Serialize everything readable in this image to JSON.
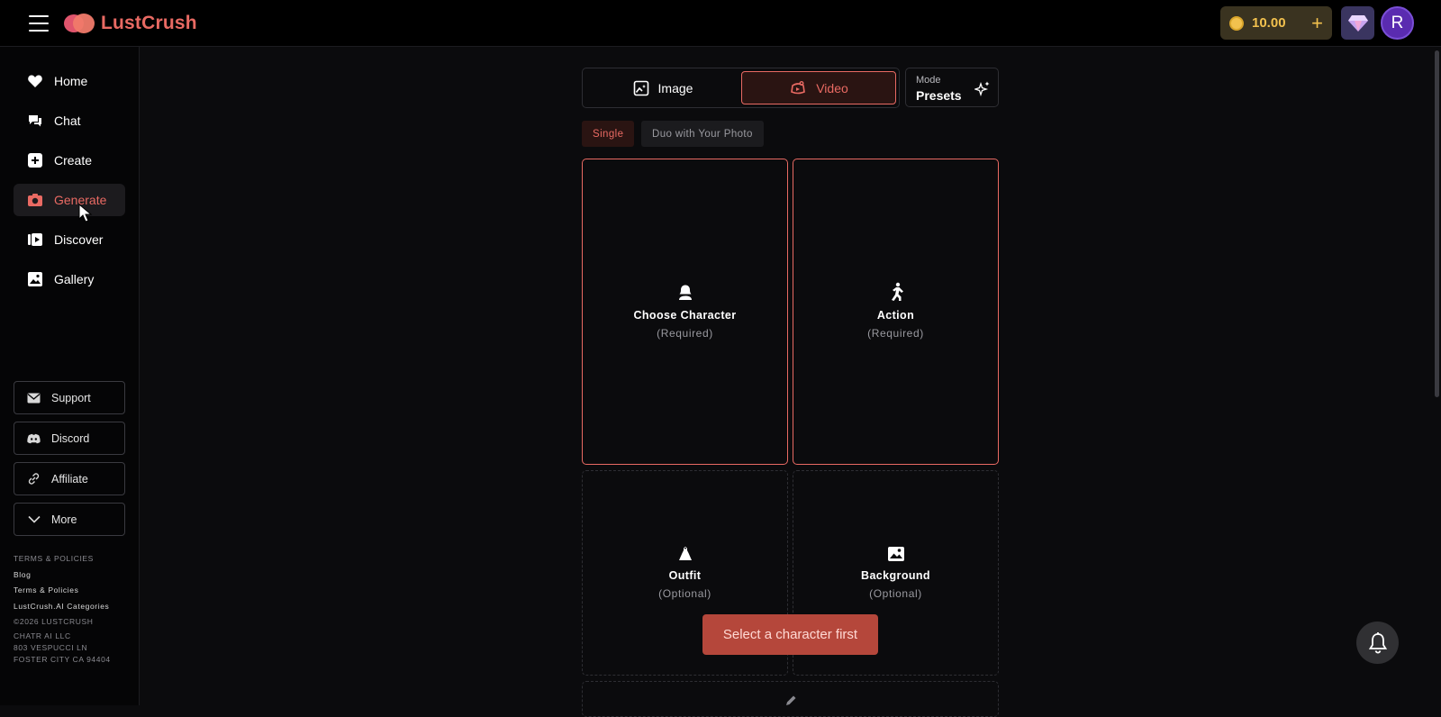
{
  "header": {
    "brand": "LustCrush",
    "coin_balance": "10.00",
    "avatar_initial": "R",
    "accent_color": "#e96a63"
  },
  "sidebar": {
    "nav": [
      {
        "label": "Home",
        "icon": "heart-icon",
        "active": false
      },
      {
        "label": "Chat",
        "icon": "chat-icon",
        "active": false
      },
      {
        "label": "Create",
        "icon": "plus-square-icon",
        "active": false
      },
      {
        "label": "Generate",
        "icon": "camera-icon",
        "active": true
      },
      {
        "label": "Discover",
        "icon": "discover-play-icon",
        "active": false
      },
      {
        "label": "Gallery",
        "icon": "gallery-icon",
        "active": false
      }
    ],
    "buttons": [
      {
        "label": "Support",
        "icon": "mail-icon"
      },
      {
        "label": "Discord",
        "icon": "discord-icon"
      },
      {
        "label": "Affiliate",
        "icon": "link-icon"
      },
      {
        "label": "More",
        "icon": "chevron-down-icon"
      }
    ],
    "footer": {
      "terms_heading": "TERMS & POLICIES",
      "blog": "Blog",
      "terms_link": "Terms & Policies",
      "categories": "LustCrush.AI Categories",
      "copyright": "©2026 LUSTCRUSH",
      "company": "CHATR AI LLC",
      "street": "803 VESPUCCI LN",
      "city": "FOSTER CITY CA 94404"
    }
  },
  "main": {
    "mode_tabs": {
      "image": "Image",
      "video": "Video",
      "selected": "Video"
    },
    "presets": {
      "label": "Mode",
      "value": "Presets"
    },
    "sub_tabs": {
      "single": "Single",
      "duo": "Duo with Your Photo",
      "selected": "Single"
    },
    "cards": {
      "character": {
        "title": "Choose Character",
        "sub": "(Required)"
      },
      "action": {
        "title": "Action",
        "sub": "(Required)"
      },
      "outfit": {
        "title": "Outfit",
        "sub": "(Optional)"
      },
      "background": {
        "title": "Background",
        "sub": "(Optional)"
      }
    },
    "primary_button": "Select a character first"
  }
}
